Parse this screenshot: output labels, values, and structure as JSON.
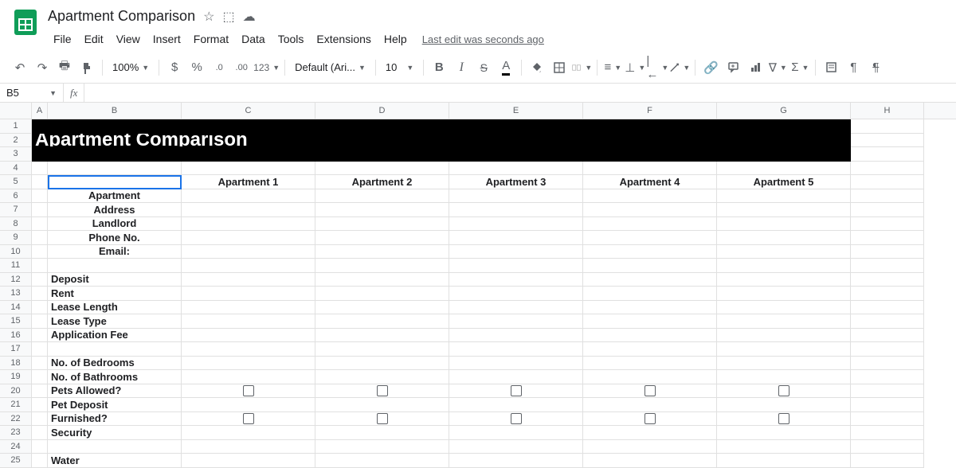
{
  "document": {
    "title": "Apartment Comparison"
  },
  "menubar": {
    "file": "File",
    "edit": "Edit",
    "view": "View",
    "insert": "Insert",
    "format": "Format",
    "data": "Data",
    "tools": "Tools",
    "extensions": "Extensions",
    "help": "Help",
    "last_edit": "Last edit was seconds ago"
  },
  "toolbar": {
    "zoom": "100%",
    "currency": "$",
    "percent": "%",
    "dec_dec": ".0",
    "inc_dec": ".00",
    "more_formats": "123",
    "font": "Default (Ari...",
    "font_size": "10"
  },
  "name_box": "B5",
  "formula": "",
  "columns": [
    "A",
    "B",
    "C",
    "D",
    "E",
    "F",
    "G",
    "H"
  ],
  "sheet": {
    "title": "Apartment Comparison",
    "headers": [
      "Apartment 1",
      "Apartment 2",
      "Apartment 3",
      "Apartment 4",
      "Apartment 5"
    ],
    "section1": [
      "Apartment",
      "Address",
      "Landlord",
      "Phone No.",
      "Email:"
    ],
    "section2": [
      "Deposit",
      "Rent",
      "Lease Length",
      "Lease Type",
      "Application Fee"
    ],
    "section3": [
      "No. of Bedrooms",
      "No. of Bathrooms",
      "Pets Allowed?",
      "Pet Deposit",
      "Furnished?",
      "Security"
    ],
    "section4": [
      "Water"
    ]
  }
}
